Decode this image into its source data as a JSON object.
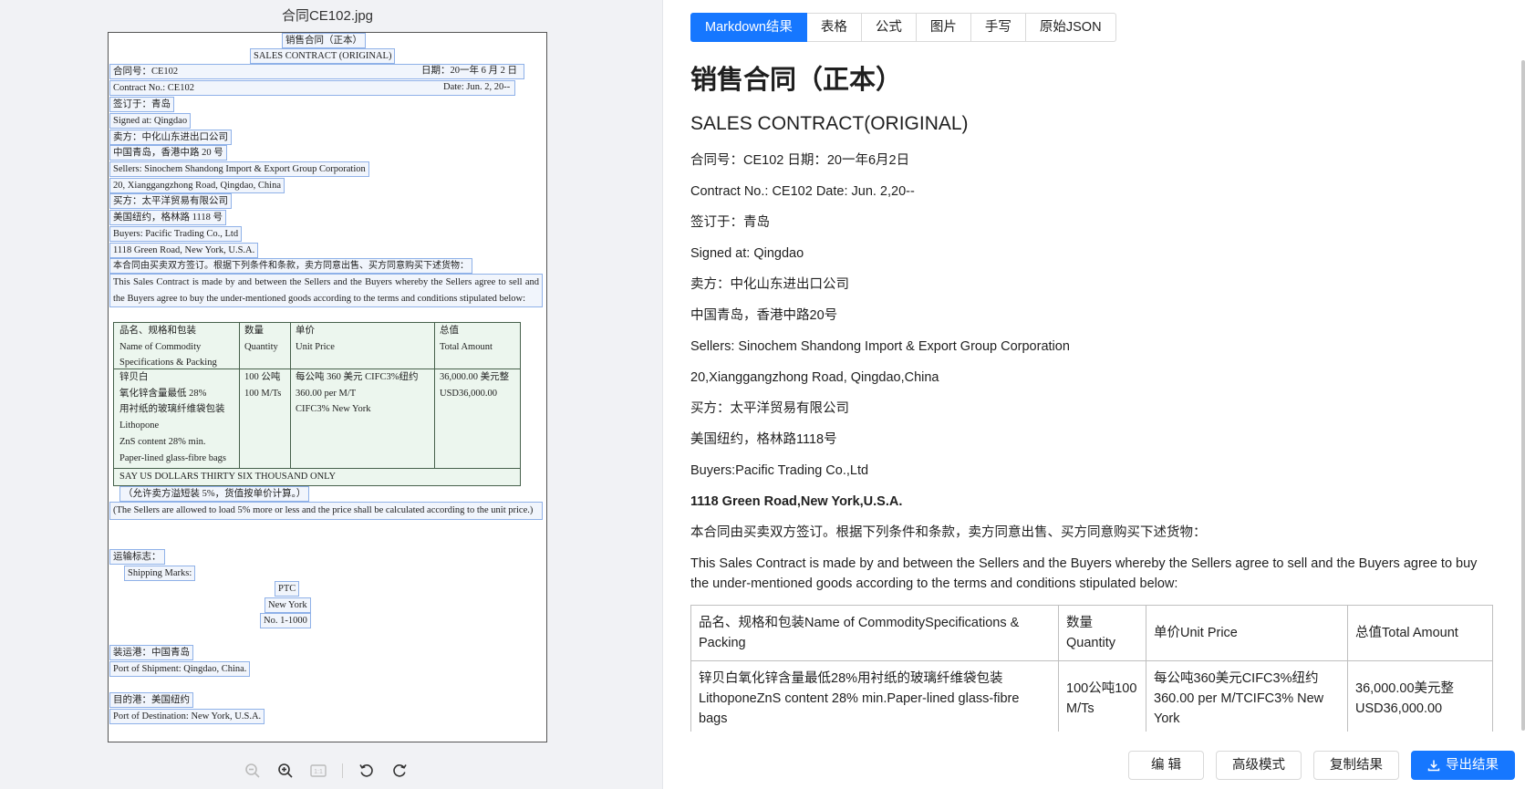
{
  "left": {
    "file_title": "合同CE102.jpg",
    "doc_lines": [
      "销售合同（正本）",
      "SALES CONTRACT (ORIGINAL)",
      "合同号：CE102",
      "日期：20一年 6 月 2 日",
      "Contract No.: CE102",
      "Date: Jun. 2, 20--",
      "签订于：青岛",
      "Signed at: Qingdao",
      "卖方：中化山东进出口公司",
      "中国青岛，香港中路 20 号",
      "Sellers: Sinochem Shandong Import & Export Group Corporation",
      "20, Xianggangzhong Road, Qingdao, China",
      "买方：太平洋贸易有限公司",
      "美国纽约，格林路 1118 号",
      "Buyers: Pacific Trading Co., Ltd",
      "1118 Green Road, New York, U.S.A.",
      "本合同由买卖双方签订。根据下列条件和条款，卖方同意出售、买方同意购买下述货物：",
      "This Sales Contract is made by and between the Sellers and the Buyers whereby the Sellers agree to sell and the Buyers agree to buy the under-mentioned goods according to the terms and conditions stipulated below:",
      "（允许卖方溢短装 5%，货值按单价计算。）",
      "(The Sellers are allowed to load 5% more or less and the price shall be calculated according to the unit price.)",
      "运输标志：",
      "Shipping Marks:",
      "PTC",
      "New York",
      "No. 1-1000",
      "装运港：中国青岛",
      "Port of Shipment: Qingdao, China.",
      "目的港：美国纽约",
      "Port of Destination: New York, U.S.A."
    ],
    "doc_table": {
      "h1": [
        "品名、规格和包装",
        "Name of Commodity",
        "Specifications & Packing"
      ],
      "h2": [
        "数量",
        "Quantity"
      ],
      "h3": [
        "单价",
        "Unit Price"
      ],
      "h4": [
        "总值",
        "Total Amount"
      ],
      "c1": [
        "锌贝白",
        "氧化锌含量最低 28%",
        "用衬纸的玻璃纤维袋包装",
        "Lithopone",
        "ZnS content 28% min.",
        "Paper-lined glass-fibre bags"
      ],
      "c2": [
        "100 公吨",
        "100 M/Ts"
      ],
      "c3": [
        "每公吨 360 美元 CIFC3%纽约",
        "360.00 per M/T",
        "CIFC3% New York"
      ],
      "c4": [
        "36,000.00 美元整",
        "USD36,000.00"
      ],
      "total": "SAY US DOLLARS THIRTY SIX THOUSAND ONLY"
    }
  },
  "tabs": [
    "Markdown结果",
    "表格",
    "公式",
    "图片",
    "手写",
    "原始JSON"
  ],
  "markdown": {
    "h1": "销售合同（正本）",
    "h2": "SALES CONTRACT(ORIGINAL)",
    "paragraphs": [
      "合同号：CE102 日期：20一年6月2日",
      "Contract No.: CE102 Date: Jun. 2,20--",
      "签订于：青岛",
      "Signed at: Qingdao",
      "卖方：中化山东进出口公司",
      "中国青岛，香港中路20号",
      "Sellers: Sinochem Shandong Import & Export Group Corporation",
      "20,Xianggangzhong Road, Qingdao,China",
      "买方：太平洋贸易有限公司",
      "美国纽约，格林路1118号",
      "Buyers:Pacific Trading Co.,Ltd",
      "1118 Green Road,New York,U.S.A.",
      "本合同由买卖双方签订。根据下列条件和条款，卖方同意出售、买方同意购买下述货物：",
      "This Sales Contract is made by and between the Sellers and the Buyers whereby the Sellers agree to sell and the Buyers agree to buy the under-mentioned goods according to the terms and conditions stipulated below:"
    ],
    "table_header": [
      "品名、规格和包装Name of CommoditySpecifications & Packing",
      "数量Quantity",
      "单价Unit Price",
      "总值Total Amount"
    ],
    "table_row": [
      "锌贝白氧化锌含量最低28%用衬纸的玻璃纤维袋包装LithoponeZnS content 28% min.Paper-lined glass-fibre bags",
      "100公吨100 M/Ts",
      "每公吨360美元CIFC3%纽约 360.00 per M/TCIFC3% New York",
      "36,000.00美元整USD36,000.00"
    ]
  },
  "actions": {
    "edit": "编 辑",
    "advanced": "高级模式",
    "copy": "复制结果",
    "export": "导出结果"
  },
  "colors": {
    "accent": "#1677ff",
    "highlight_border": "#8fb1e8",
    "table_fill": "#e3f1e5"
  }
}
